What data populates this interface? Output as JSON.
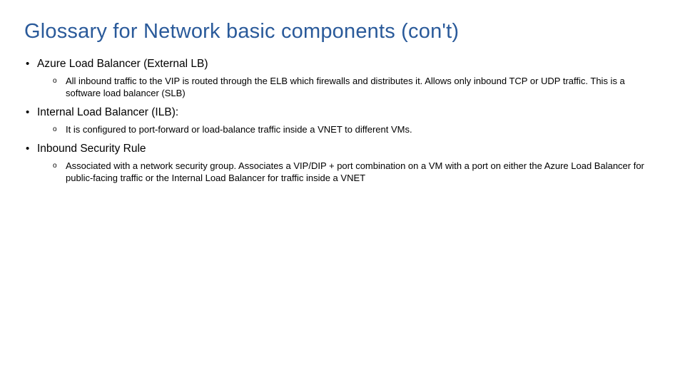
{
  "title": "Glossary for Network basic components (con't)",
  "items": [
    {
      "term": "Azure Load Balancer (External LB)",
      "desc": "All inbound traffic to the VIP is routed through the ELB which firewalls and distributes it. Allows only inbound TCP or UDP traffic. This is a software load balancer (SLB)"
    },
    {
      "term": "Internal Load Balancer (ILB):",
      "desc": "It is configured to port-forward or load-balance traffic inside a VNET to different VMs."
    },
    {
      "term": "Inbound Security Rule",
      "desc": "Associated with a network security group. Associates a VIP/DIP + port combination on a VM with a port on either the Azure Load Balancer for public-facing traffic or the Internal Load Balancer for traffic inside a VNET"
    }
  ]
}
